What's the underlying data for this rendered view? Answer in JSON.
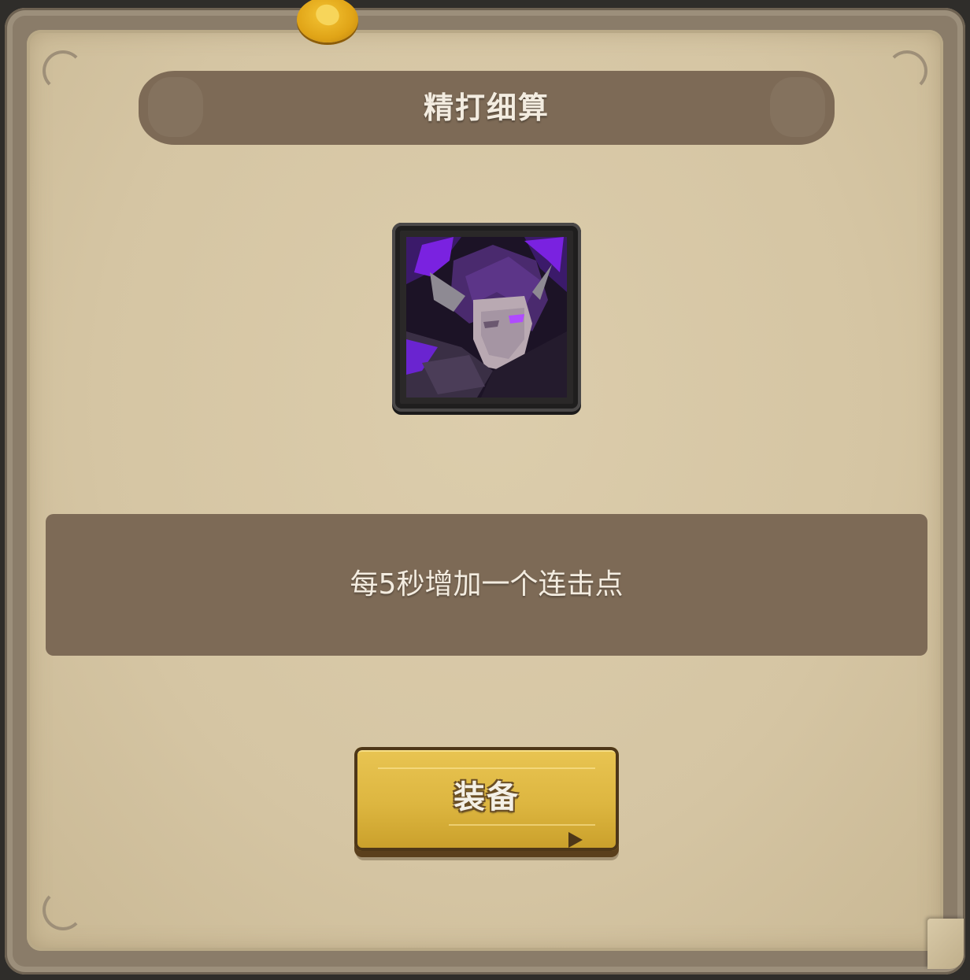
{
  "dialog": {
    "title": "精打细算",
    "description": "每5秒增加一个连击点",
    "equip_label": "装备"
  },
  "portrait": {
    "icon": "purple-hooded-rogue-portrait"
  },
  "colors": {
    "banner": "#7d6a56",
    "parchment": "#d5c5a3",
    "button": "#ddb640",
    "portrait_glow": "#7a22e0"
  }
}
